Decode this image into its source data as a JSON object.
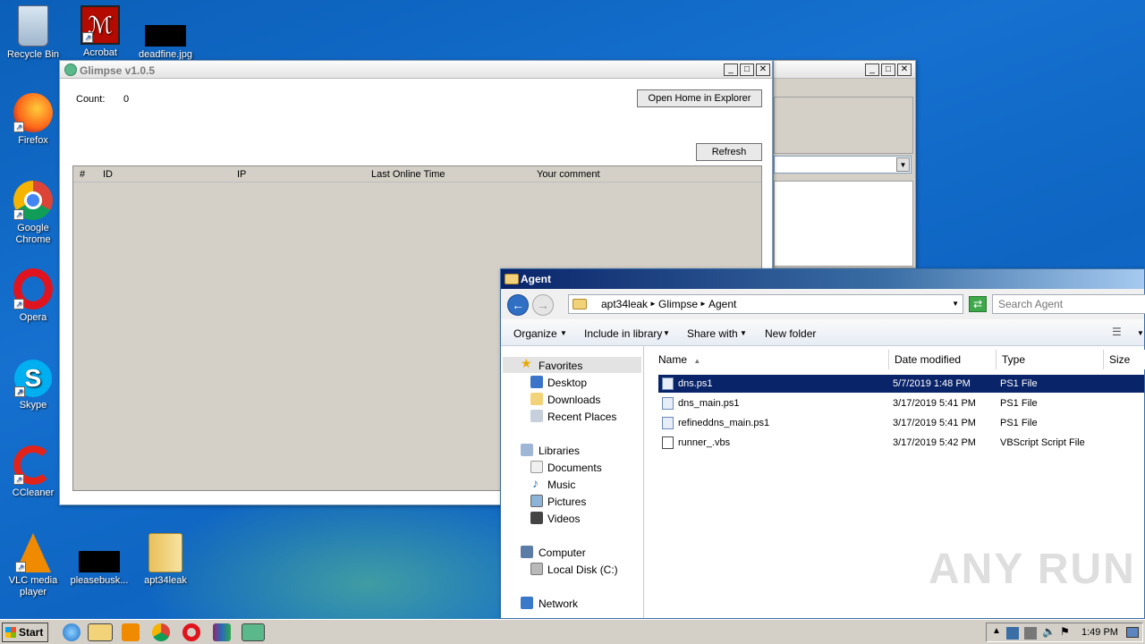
{
  "desktop": {
    "icons": [
      {
        "label": "Recycle Bin"
      },
      {
        "label": "Acrobat"
      },
      {
        "label": "deadfine.jpg"
      },
      {
        "label": "Firefox"
      },
      {
        "label": "Google Chrome"
      },
      {
        "label": "Opera"
      },
      {
        "label": "Skype"
      },
      {
        "label": "CCleaner"
      },
      {
        "label": "VLC media player"
      },
      {
        "label": "pleasebusk..."
      },
      {
        "label": "apt34leak"
      }
    ],
    "watermark": "ANY RUN"
  },
  "glimpse": {
    "title": "Glimpse v1.0.5",
    "count_label": "Count:",
    "count_value": "0",
    "open_home_label": "Open Home in Explorer",
    "refresh_label": "Refresh",
    "columns": [
      "#",
      "ID",
      "IP",
      "Last Online Time",
      "Your comment"
    ]
  },
  "explorer": {
    "title": "Agent",
    "breadcrumb": [
      "apt34leak",
      "Glimpse",
      "Agent"
    ],
    "search_placeholder": "Search Agent",
    "toolbar": {
      "organize": "Organize",
      "include": "Include in library",
      "share": "Share with",
      "new_folder": "New folder"
    },
    "nav": {
      "favorites": "Favorites",
      "desktop": "Desktop",
      "downloads": "Downloads",
      "recent": "Recent Places",
      "libraries": "Libraries",
      "documents": "Documents",
      "music": "Music",
      "pictures": "Pictures",
      "videos": "Videos",
      "computer": "Computer",
      "local_disk": "Local Disk (C:)",
      "network": "Network"
    },
    "columns": {
      "name": "Name",
      "date": "Date modified",
      "type": "Type",
      "size": "Size"
    },
    "files": [
      {
        "name": "dns.ps1",
        "date": "5/7/2019 1:48 PM",
        "type": "PS1 File"
      },
      {
        "name": "dns_main.ps1",
        "date": "3/17/2019 5:41 PM",
        "type": "PS1 File"
      },
      {
        "name": "refineddns_main.ps1",
        "date": "3/17/2019 5:41 PM",
        "type": "PS1 File"
      },
      {
        "name": "runner_.vbs",
        "date": "3/17/2019 5:42 PM",
        "type": "VBScript Script File"
      }
    ]
  },
  "taskbar": {
    "start_label": "Start",
    "clock": "1:49 PM"
  },
  "colors": {
    "desktop": "#1570cf",
    "selection": "#0a246a",
    "explorer_title": "#0a246a"
  }
}
